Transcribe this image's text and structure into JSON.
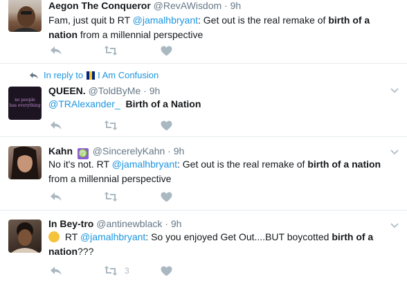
{
  "tweets": [
    {
      "name": "Aegon The Conqueror",
      "handle": "@RevAWisdom",
      "time": "9h",
      "text_pre": "Fam, just quit b RT ",
      "mention": "@jamalhbryant",
      "text_mid": ": Get out is the real remake of ",
      "text_bold": "birth of a nation",
      "text_post": " from a millennial perspective",
      "retweet_count": "",
      "avatar_icon": "person-avatar"
    },
    {
      "reply_prefix": "In reply to",
      "reply_to": "I Am Confusion",
      "name": "QUEEN.",
      "handle": "@ToldByMe",
      "time": "9h",
      "mention": "@TRAlexander_",
      "text_bold": "Birth of a Nation",
      "avatar_text": "no people\nhas everything",
      "avatar_icon": "dark-purple-avatar"
    },
    {
      "name": "Kahn",
      "badge": "♍",
      "handle": "@SincerelyKahn",
      "time": "9h",
      "text_pre": "No it's not.  RT ",
      "mention": "@jamalhbryant",
      "text_mid": ": Get out is the real remake of ",
      "text_bold": "birth of a nation",
      "text_post": " from a millennial perspective",
      "avatar_icon": "person-avatar"
    },
    {
      "name": "In Bey-tro",
      "handle": "@antinewblack",
      "time": "9h",
      "text_pre": " RT ",
      "mention": "@jamalhbryant",
      "text_mid": ": So you enjoyed Get Out....BUT boycotted ",
      "text_bold": "birth of a nation",
      "text_post": "???",
      "retweet_count": "3",
      "avatar_icon": "person-avatar"
    }
  ],
  "colors": {
    "link": "#1b95e0",
    "muted": "#657786",
    "icon": "#aab8c2",
    "divider": "#e6ecf0"
  }
}
